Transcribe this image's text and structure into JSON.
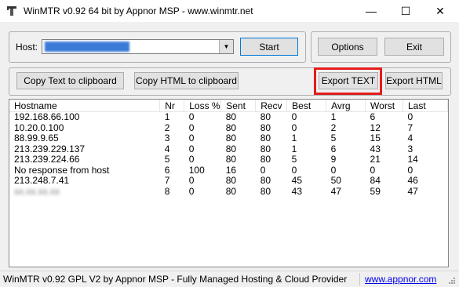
{
  "window": {
    "title": "WinMTR v0.92 64 bit by Appnor MSP - www.winmtr.net",
    "icon": "hammer-icon",
    "minimize_glyph": "—",
    "maximize_glyph": "☐",
    "close_glyph": "✕"
  },
  "host": {
    "label": "Host:",
    "value": "xxxxxxxxxxxxxxx"
  },
  "buttons": {
    "start": "Start",
    "options": "Options",
    "exit": "Exit",
    "copy_text": "Copy Text to clipboard",
    "copy_html": "Copy HTML to clipboard",
    "export_text": "Export TEXT",
    "export_html": "Export HTML"
  },
  "table": {
    "columns": [
      "Hostname",
      "Nr",
      "Loss %",
      "Sent",
      "Recv",
      "Best",
      "Avrg",
      "Worst",
      "Last"
    ],
    "rows": [
      [
        "192.168.66.100",
        "1",
        "0",
        "80",
        "80",
        "0",
        "1",
        "6",
        "0"
      ],
      [
        "10.20.0.100",
        "2",
        "0",
        "80",
        "80",
        "0",
        "2",
        "12",
        "7"
      ],
      [
        "88.99.9.65",
        "3",
        "0",
        "80",
        "80",
        "1",
        "5",
        "15",
        "4"
      ],
      [
        "213.239.229.137",
        "4",
        "0",
        "80",
        "80",
        "1",
        "6",
        "43",
        "3"
      ],
      [
        "213.239.224.66",
        "5",
        "0",
        "80",
        "80",
        "5",
        "9",
        "21",
        "14"
      ],
      [
        "No response from host",
        "6",
        "100",
        "16",
        "0",
        "0",
        "0",
        "0",
        "0"
      ],
      [
        "213.248.7.41",
        "7",
        "0",
        "80",
        "80",
        "45",
        "50",
        "84",
        "46"
      ],
      [
        "xx.xx.xx.xx",
        "8",
        "0",
        "80",
        "80",
        "43",
        "47",
        "59",
        "47"
      ]
    ]
  },
  "status": {
    "text": "WinMTR v0.92 GPL V2 by Appnor MSP - Fully Managed Hosting & Cloud Provider",
    "link": "www.appnor.com"
  }
}
